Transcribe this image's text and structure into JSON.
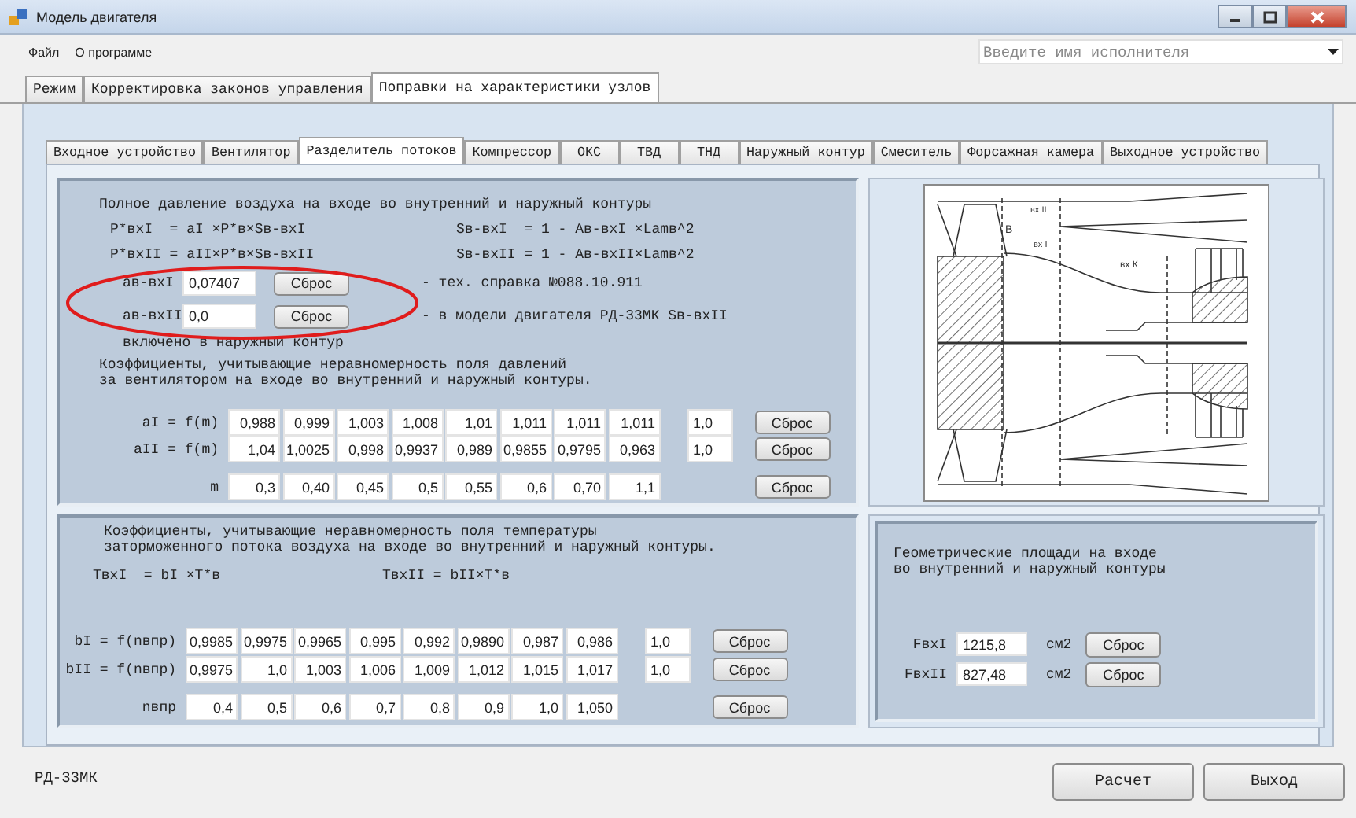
{
  "window": {
    "title": "Модель двигателя"
  },
  "menu": [
    "Файл",
    "О программе"
  ],
  "performer_field": {
    "placeholder": "Введите имя исполнителя"
  },
  "main_tabs": [
    {
      "label": "Режим",
      "selected": false
    },
    {
      "label": "Корректировка законов управления",
      "selected": false
    },
    {
      "label": "Поправки на характеристики узлов",
      "selected": true
    }
  ],
  "unit_tabs": [
    {
      "label": "Входное устройство",
      "selected": false
    },
    {
      "label": "Вентилятор",
      "selected": false
    },
    {
      "label": "Разделитель потоков",
      "selected": true
    },
    {
      "label": "Компрессор",
      "selected": false
    },
    {
      "label": "ОКС",
      "selected": false
    },
    {
      "label": "ТВД",
      "selected": false
    },
    {
      "label": "ТНД",
      "selected": false
    },
    {
      "label": "Наружный контур",
      "selected": false
    },
    {
      "label": "Смеситель",
      "selected": false
    },
    {
      "label": "Форсажная камера",
      "selected": false
    },
    {
      "label": "Выходное устройство",
      "selected": false
    }
  ],
  "pressure_panel": {
    "heading": "Полное давление воздуха на входе во внутренний и наружный контуры",
    "formulas": [
      [
        "P*вхI  = aI ×P*в×Sв-вхI",
        "Sв-вхI  = 1 - Aв-вхI ×Lamв^2"
      ],
      [
        "P*вхII = aII×P*в×Sв-вхII",
        "Sв-вхII = 1 - Aв-вхII×Lamв^2"
      ]
    ],
    "params": [
      {
        "label": "aв-вхI",
        "value": "0,07407",
        "button": "Сброс",
        "note": "- тех. справка №088.10.911"
      },
      {
        "label": "aв-вхII",
        "value": "0,0",
        "button": "Сброс",
        "note": "- в модели двигателя РД-33МК Sв-вхII"
      }
    ],
    "note_continued": "включено в наружный контур",
    "coef_heading": [
      "Коэффициенты, учитывающие неравномерность поля давлений",
      "за вентилятором на входе во внутренний и наружный контуры."
    ],
    "rows": [
      {
        "label": "aI = f(m)",
        "values": [
          "0,988",
          "0,999",
          "1,003",
          "1,008",
          "1,01",
          "1,011",
          "1,011",
          "1,011"
        ],
        "extra": "1,0",
        "button": "Сброс"
      },
      {
        "label": "aII = f(m)",
        "values": [
          "1,04",
          "1,0025",
          "0,998",
          "0,9937",
          "0,989",
          "0,9855",
          "0,9795",
          "0,963"
        ],
        "extra": "1,0",
        "button": "Сброс"
      },
      {
        "label": "m",
        "values": [
          "0,3",
          "0,40",
          "0,45",
          "0,5",
          "0,55",
          "0,6",
          "0,70",
          "1,1"
        ],
        "button": "Сброс"
      }
    ]
  },
  "diagram": {
    "labels": [
      "В",
      "вх II",
      "вх I",
      "вх К"
    ]
  },
  "temperature_panel": {
    "heading": [
      "Коэффициенты, учитывающие неравномерность поля температуры",
      "заторможенного потока воздуха на входе во внутренний и наружный контуры."
    ],
    "formulas": [
      "TвхI  = bI ×T*в",
      "TвхII = bII×T*в"
    ],
    "rows": [
      {
        "label": "bI = f(nвпр)",
        "values": [
          "0,9985",
          "0,9975",
          "0,9965",
          "0,995",
          "0,992",
          "0,9890",
          "0,987",
          "0,986"
        ],
        "extra": "1,0",
        "button": "Сброс"
      },
      {
        "label": "bII = f(nвпр)",
        "values": [
          "0,9975",
          "1,0",
          "1,003",
          "1,006",
          "1,009",
          "1,012",
          "1,015",
          "1,017"
        ],
        "extra": "1,0",
        "button": "Сброс"
      },
      {
        "label": "nвпр",
        "values": [
          "0,4",
          "0,5",
          "0,6",
          "0,7",
          "0,8",
          "0,9",
          "1,0",
          "1,050"
        ],
        "button": "Сброс"
      }
    ]
  },
  "area_panel": {
    "heading": [
      "Геометрические площади на входе",
      "во внутренний и наружный контуры"
    ],
    "rows": [
      {
        "label": "FвхI",
        "value": "1215,8",
        "unit": "см2",
        "button": "Сброс"
      },
      {
        "label": "FвхII",
        "value": "827,48",
        "unit": "см2",
        "button": "Сброс"
      }
    ]
  },
  "footer": {
    "engine": "РД-33МК",
    "buttons": [
      "Расчет",
      "Выход"
    ]
  },
  "annotations": [
    {
      "kind": "ellipse"
    }
  ]
}
